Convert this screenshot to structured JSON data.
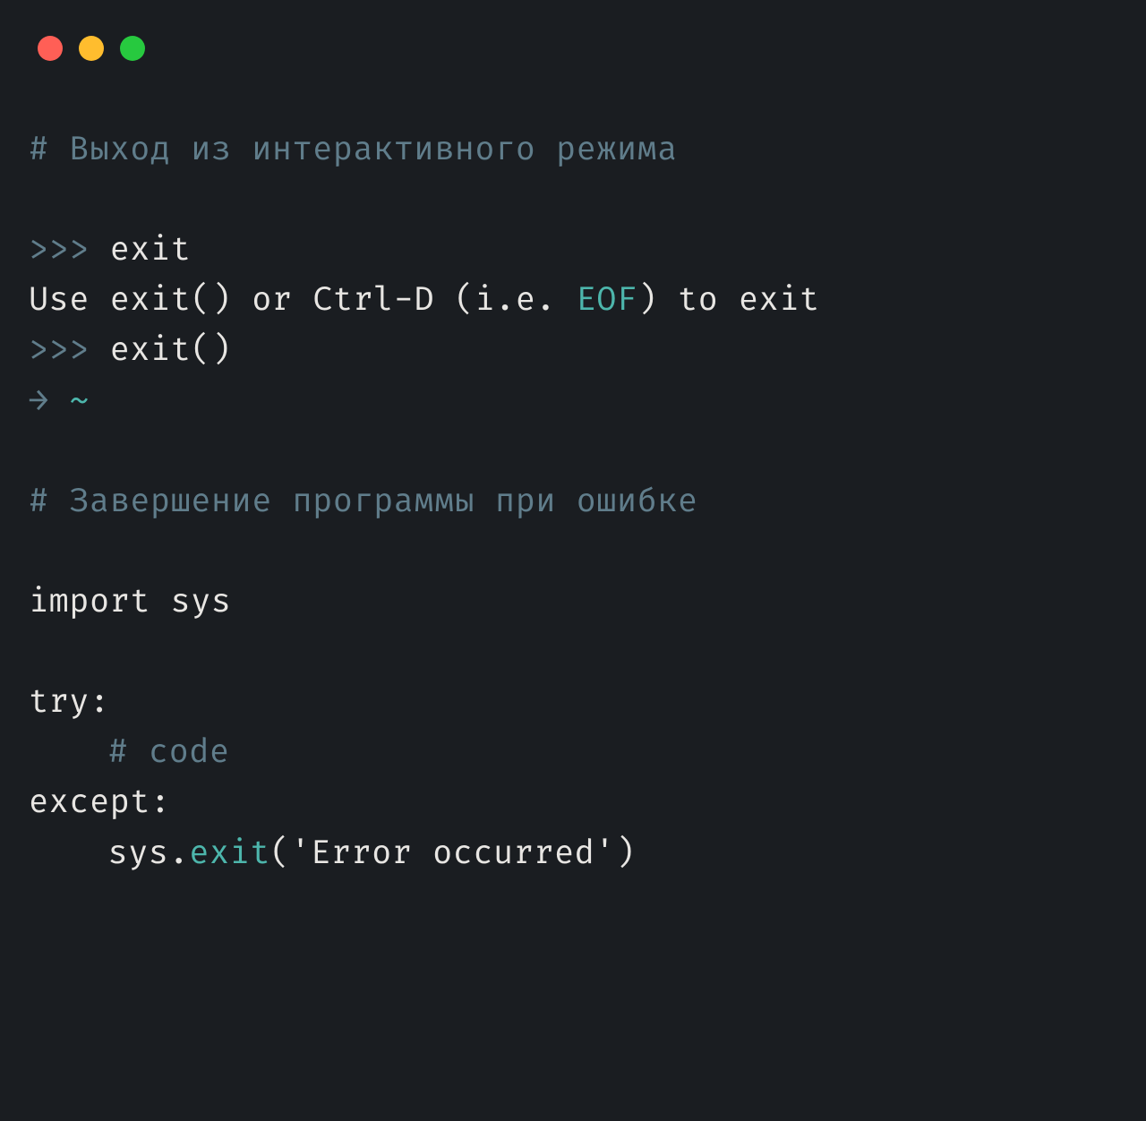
{
  "window": {
    "controls": {
      "close": "close",
      "minimize": "minimize",
      "maximize": "maximize"
    }
  },
  "lines": {
    "comment1": "# Выход из интерактивного режима",
    "prompt1": ">>> ",
    "exit_cmd": "exit",
    "use_msg_pre": "Use exit() or Ctrl-D (i.e. ",
    "eof": "EOF",
    "use_msg_post": ") to exit",
    "prompt2": ">>> ",
    "exit_call": "exit()",
    "shell_arrow": "→ ",
    "tilde": "~",
    "comment2": "# Завершение программы при ошибке",
    "import_kw": "import ",
    "import_mod": "sys",
    "try_kw": "try:",
    "code_comment": "# code",
    "except_kw": "except:",
    "sys_obj": "sys.",
    "exit_fn": "exit",
    "exit_args": "('Error occurred')"
  }
}
